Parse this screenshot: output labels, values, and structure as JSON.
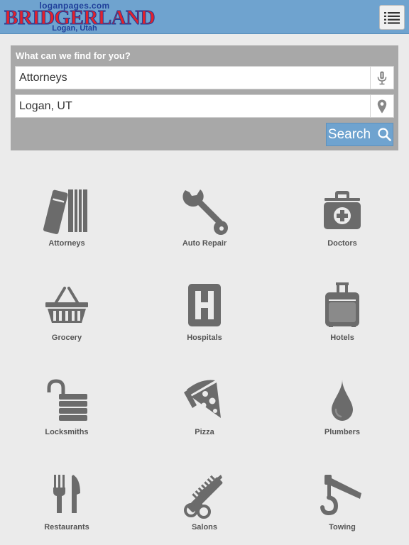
{
  "header": {
    "logo": {
      "url_text": "loganpages.com",
      "brand": "BRIDGERLAND",
      "city": "Logan, Utah"
    },
    "menu_icon": "list-icon"
  },
  "search": {
    "title": "What can we find for you?",
    "what_value": "Attorneys",
    "where_value": "Logan, UT",
    "mic_icon": "microphone-icon",
    "location_icon": "map-pin-icon",
    "button_label": "Search",
    "button_icon": "search-icon"
  },
  "categories": [
    {
      "label": "Attorneys",
      "icon": "law-books-icon"
    },
    {
      "label": "Auto Repair",
      "icon": "wrench-icon"
    },
    {
      "label": "Doctors",
      "icon": "medical-kit-icon"
    },
    {
      "label": "Grocery",
      "icon": "basket-icon"
    },
    {
      "label": "Hospitals",
      "icon": "hospital-icon"
    },
    {
      "label": "Hotels",
      "icon": "luggage-icon"
    },
    {
      "label": "Locksmiths",
      "icon": "padlock-icon"
    },
    {
      "label": "Pizza",
      "icon": "pizza-slice-icon"
    },
    {
      "label": "Plumbers",
      "icon": "water-drop-icon"
    },
    {
      "label": "Restaurants",
      "icon": "fork-knife-icon"
    },
    {
      "label": "Salons",
      "icon": "comb-scissors-icon"
    },
    {
      "label": "Towing",
      "icon": "tow-hook-icon"
    }
  ],
  "colors": {
    "header_bg": "#6fa3cf",
    "page_bg": "#ebebeb",
    "panel_bg": "#a8a8a8",
    "icon_gray": "#6b6b6b",
    "brand_red": "#e4222b",
    "brand_blue": "#1f3f9a"
  }
}
